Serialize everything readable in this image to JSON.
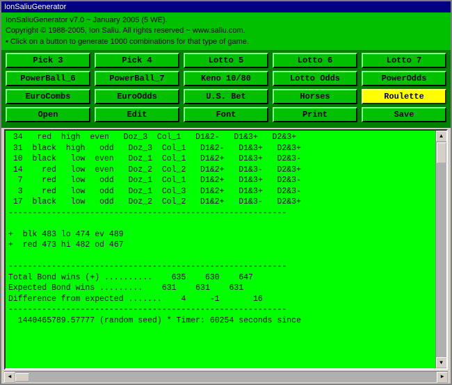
{
  "titlebar": {
    "label": "IonSaliuGenerator"
  },
  "header": {
    "line1": "IonSaliuGenerator v7.0 ~ January 2005 (5 WE).",
    "line2": "Copyright © 1988-2005, Ion Saliu. All rights reserved ~ www.saliu.com.",
    "line3": "• Click on a button to generate 1000 combinations for that type of game."
  },
  "buttons": {
    "row1": [
      "Pick 3",
      "Pick 4",
      "Lotto 5",
      "Lotto 6",
      "Lotto 7"
    ],
    "row2": [
      "PowerBall_6",
      "PowerBall_7",
      "Keno 10/80",
      "Lotto Odds",
      "PowerOdds"
    ],
    "row3": [
      "EuroCombs",
      "EuroOdds",
      "U.S. Bet",
      "Horses",
      "Roulette"
    ],
    "row4": [
      "Open",
      "Edit",
      "Font",
      "Print",
      "Save"
    ]
  },
  "output": {
    "content": " 34   red  high  even   Doz_3  Col_1   D1&2-   D1&3+   D2&3+\n 31  black  high   odd   Doz_3  Col_1   D1&2-   D1&3+   D2&3+\n 10  black   low  even   Doz_1  Col_1   D1&2+   D1&3+   D2&3-\n 14    red   low  even   Doz_2  Col_2   D1&2+   D1&3-   D2&3+\n  7    red   low   odd   Doz_1  Col_1   D1&2+   D1&3+   D2&3-\n  3    red   low   odd   Doz_1  Col_3   D1&2+   D1&3+   D2&3-\n 17  black   low   odd   Doz_2  Col_2   D1&2+   D1&3-   D2&3+\n----------------------------------------------------------\n\n+  blk 483 lo 474 ev 489\n+  red 473 hi 482 od 467\n\n----------------------------------------------------------\nTotal Bond wins (+) ..........    635    630    647\nExpected Bond wins .........    631    631    631\nDifference from expected .......    4     -1       16\n----------------------------------------------------------\n  1440465789.57777 (random seed) * Timer: 60254 seconds since"
  },
  "icons": {
    "up_arrow": "▲",
    "down_arrow": "▼",
    "left_arrow": "◄",
    "right_arrow": "►"
  }
}
